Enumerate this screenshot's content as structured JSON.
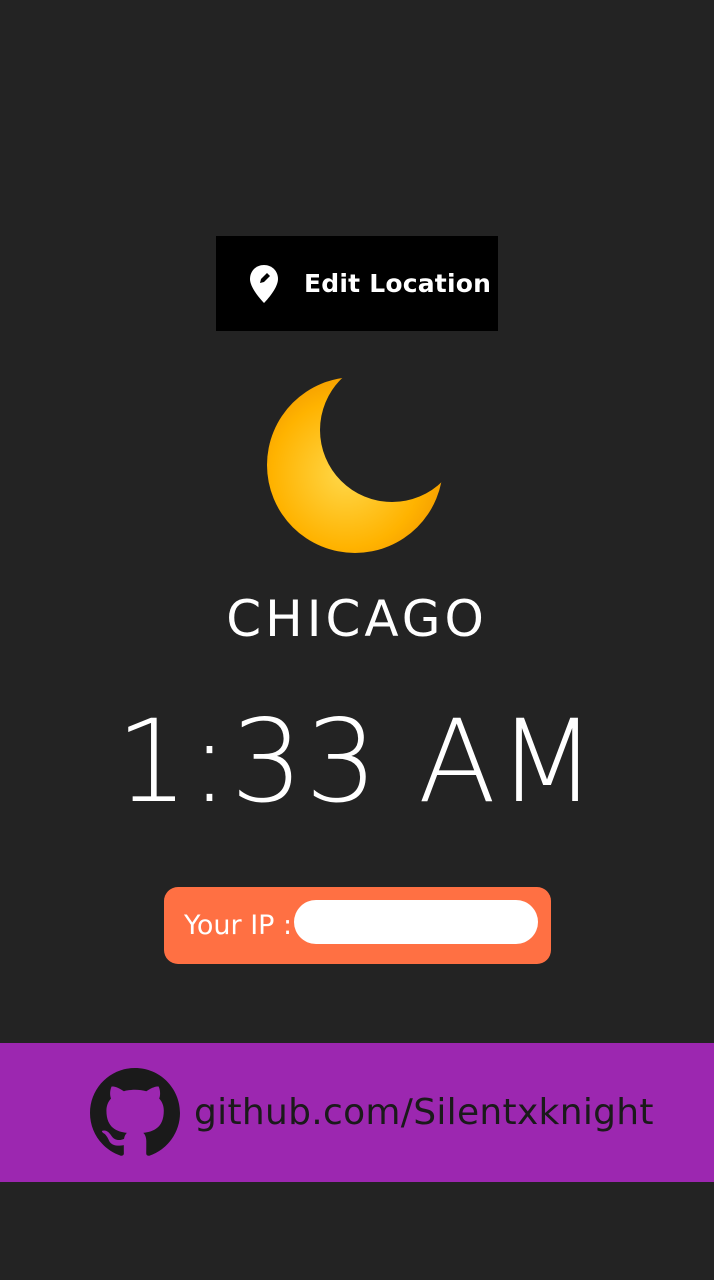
{
  "edit_location": {
    "label": "Edit Location",
    "icon": "map-pin-edit-icon"
  },
  "weather": {
    "icon": "crescent-moon-icon"
  },
  "location": {
    "city": "CHICAGO"
  },
  "clock": {
    "time": "1:33 AM"
  },
  "ip": {
    "label": "Your IP :"
  },
  "footer": {
    "icon": "github-icon",
    "link_text": "github.com/Silentxknight"
  },
  "colors": {
    "background": "#232323",
    "edit_button": "#000000",
    "ip_pill": "#ff7043",
    "footer": "#9c27b0",
    "moon": "#ffb300"
  }
}
